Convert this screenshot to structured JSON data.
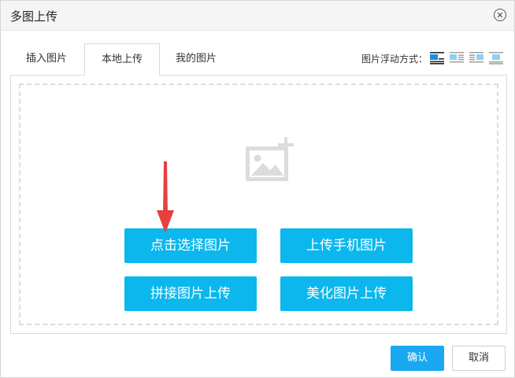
{
  "dialog": {
    "title": "多图上传",
    "close_symbol": "✕"
  },
  "tabs": [
    {
      "label": "插入图片"
    },
    {
      "label": "本地上传",
      "active": true
    },
    {
      "label": "我的图片"
    }
  ],
  "float_options": {
    "label": "图片浮动方式：",
    "icons": [
      "float-none-icon",
      "float-left-icon",
      "float-right-icon",
      "float-center-icon"
    ],
    "selected_index": 0
  },
  "upload_area": {
    "placeholder_icon": "image-add-icon",
    "buttons": [
      {
        "label": "点击选择图片"
      },
      {
        "label": "上传手机图片"
      },
      {
        "label": "拼接图片上传"
      },
      {
        "label": "美化图片上传"
      }
    ]
  },
  "footer": {
    "confirm_label": "确认",
    "cancel_label": "取消"
  },
  "colors": {
    "primary_button": "#0bb7ec",
    "confirm_button": "#1aa8f3",
    "arrow": "#e8403f"
  }
}
